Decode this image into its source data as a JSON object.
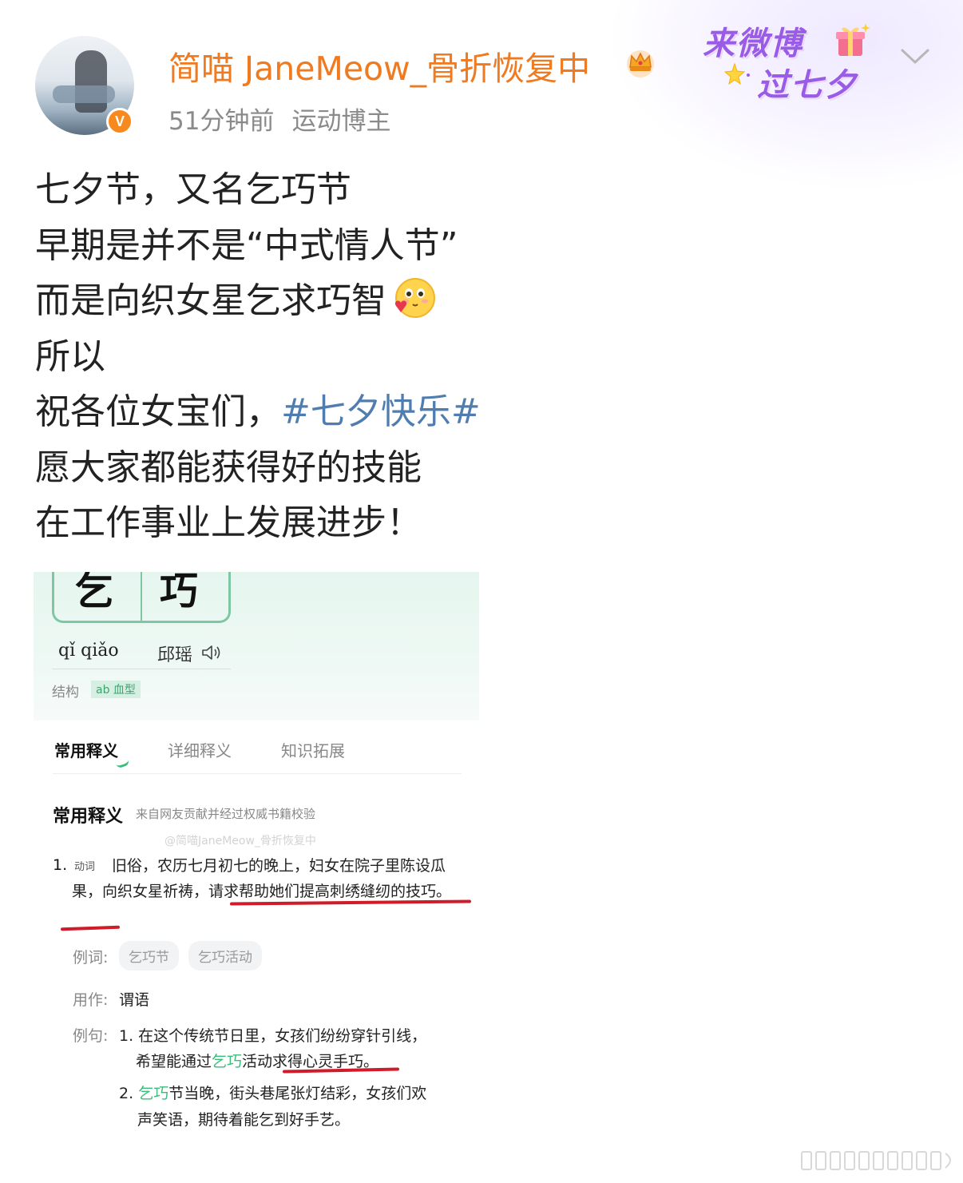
{
  "header": {
    "username": "简喵 JaneMeow_骨折恢复中",
    "verified_badge": "V",
    "time": "51分钟前",
    "tag": "运动博主",
    "event_badge": {
      "line1": "来微博",
      "line2": "过七夕"
    }
  },
  "post": {
    "lines": [
      "七夕节，又名乞巧节",
      "早期是并不是“中式情人节”",
      "而是向织女星乞求巧智",
      "所以",
      "祝各位女宝们，",
      "愿大家都能获得好的技能",
      "在工作事业上发展进步！"
    ],
    "hashtag": "#七夕快乐#"
  },
  "dict": {
    "chars": [
      "乞",
      "巧"
    ],
    "pinyin": "qǐ qiǎo",
    "homophone": "邱瑶",
    "structure_label": "结构",
    "structure_tag": "ab 血型",
    "tabs": [
      "常用释义",
      "详细释义",
      "知识拓展"
    ],
    "section_title": "常用释义",
    "section_sub": "来自网友贡献并经过权威书籍校验",
    "watermark": "@简喵JaneMeow_骨折恢复中",
    "definition": {
      "num": "1.",
      "pos": "动词",
      "text": "旧俗，农历七月初七的晚上，妇女在院子里陈设瓜果，向织女星祈祷，请求帮助她们提高刺绣缝纫的技巧。"
    },
    "example_words_label": "例词:",
    "example_words": [
      "乞巧节",
      "乞巧活动"
    ],
    "usage_label": "用作:",
    "usage_value": "谓语",
    "example_sentences_label": "例句:",
    "sentence1": {
      "line1": "1. 在这个传统节日里，女孩们纷纷穿针引线，",
      "line2_pre": "希望能通过",
      "line2_green": "乞巧",
      "line2_post": "活动求得心灵手巧。"
    },
    "sentence2": {
      "num": "2.",
      "green": "乞巧",
      "line1_post": "节当晚，街头巷尾张灯结彩，女孩们欢",
      "line2": "声笑语，期待着能乞到好手艺。"
    }
  },
  "colors": {
    "username": "#f07a1f",
    "hashtag": "#507daf",
    "event_purple": "#9a5ce6",
    "underline_red": "#cf1b2a",
    "dict_green": "#3bbd7a"
  },
  "icons": [
    "crown-icon",
    "gift-icon",
    "star-icon",
    "chevron-down-icon",
    "emoji-icon",
    "speaker-icon"
  ]
}
